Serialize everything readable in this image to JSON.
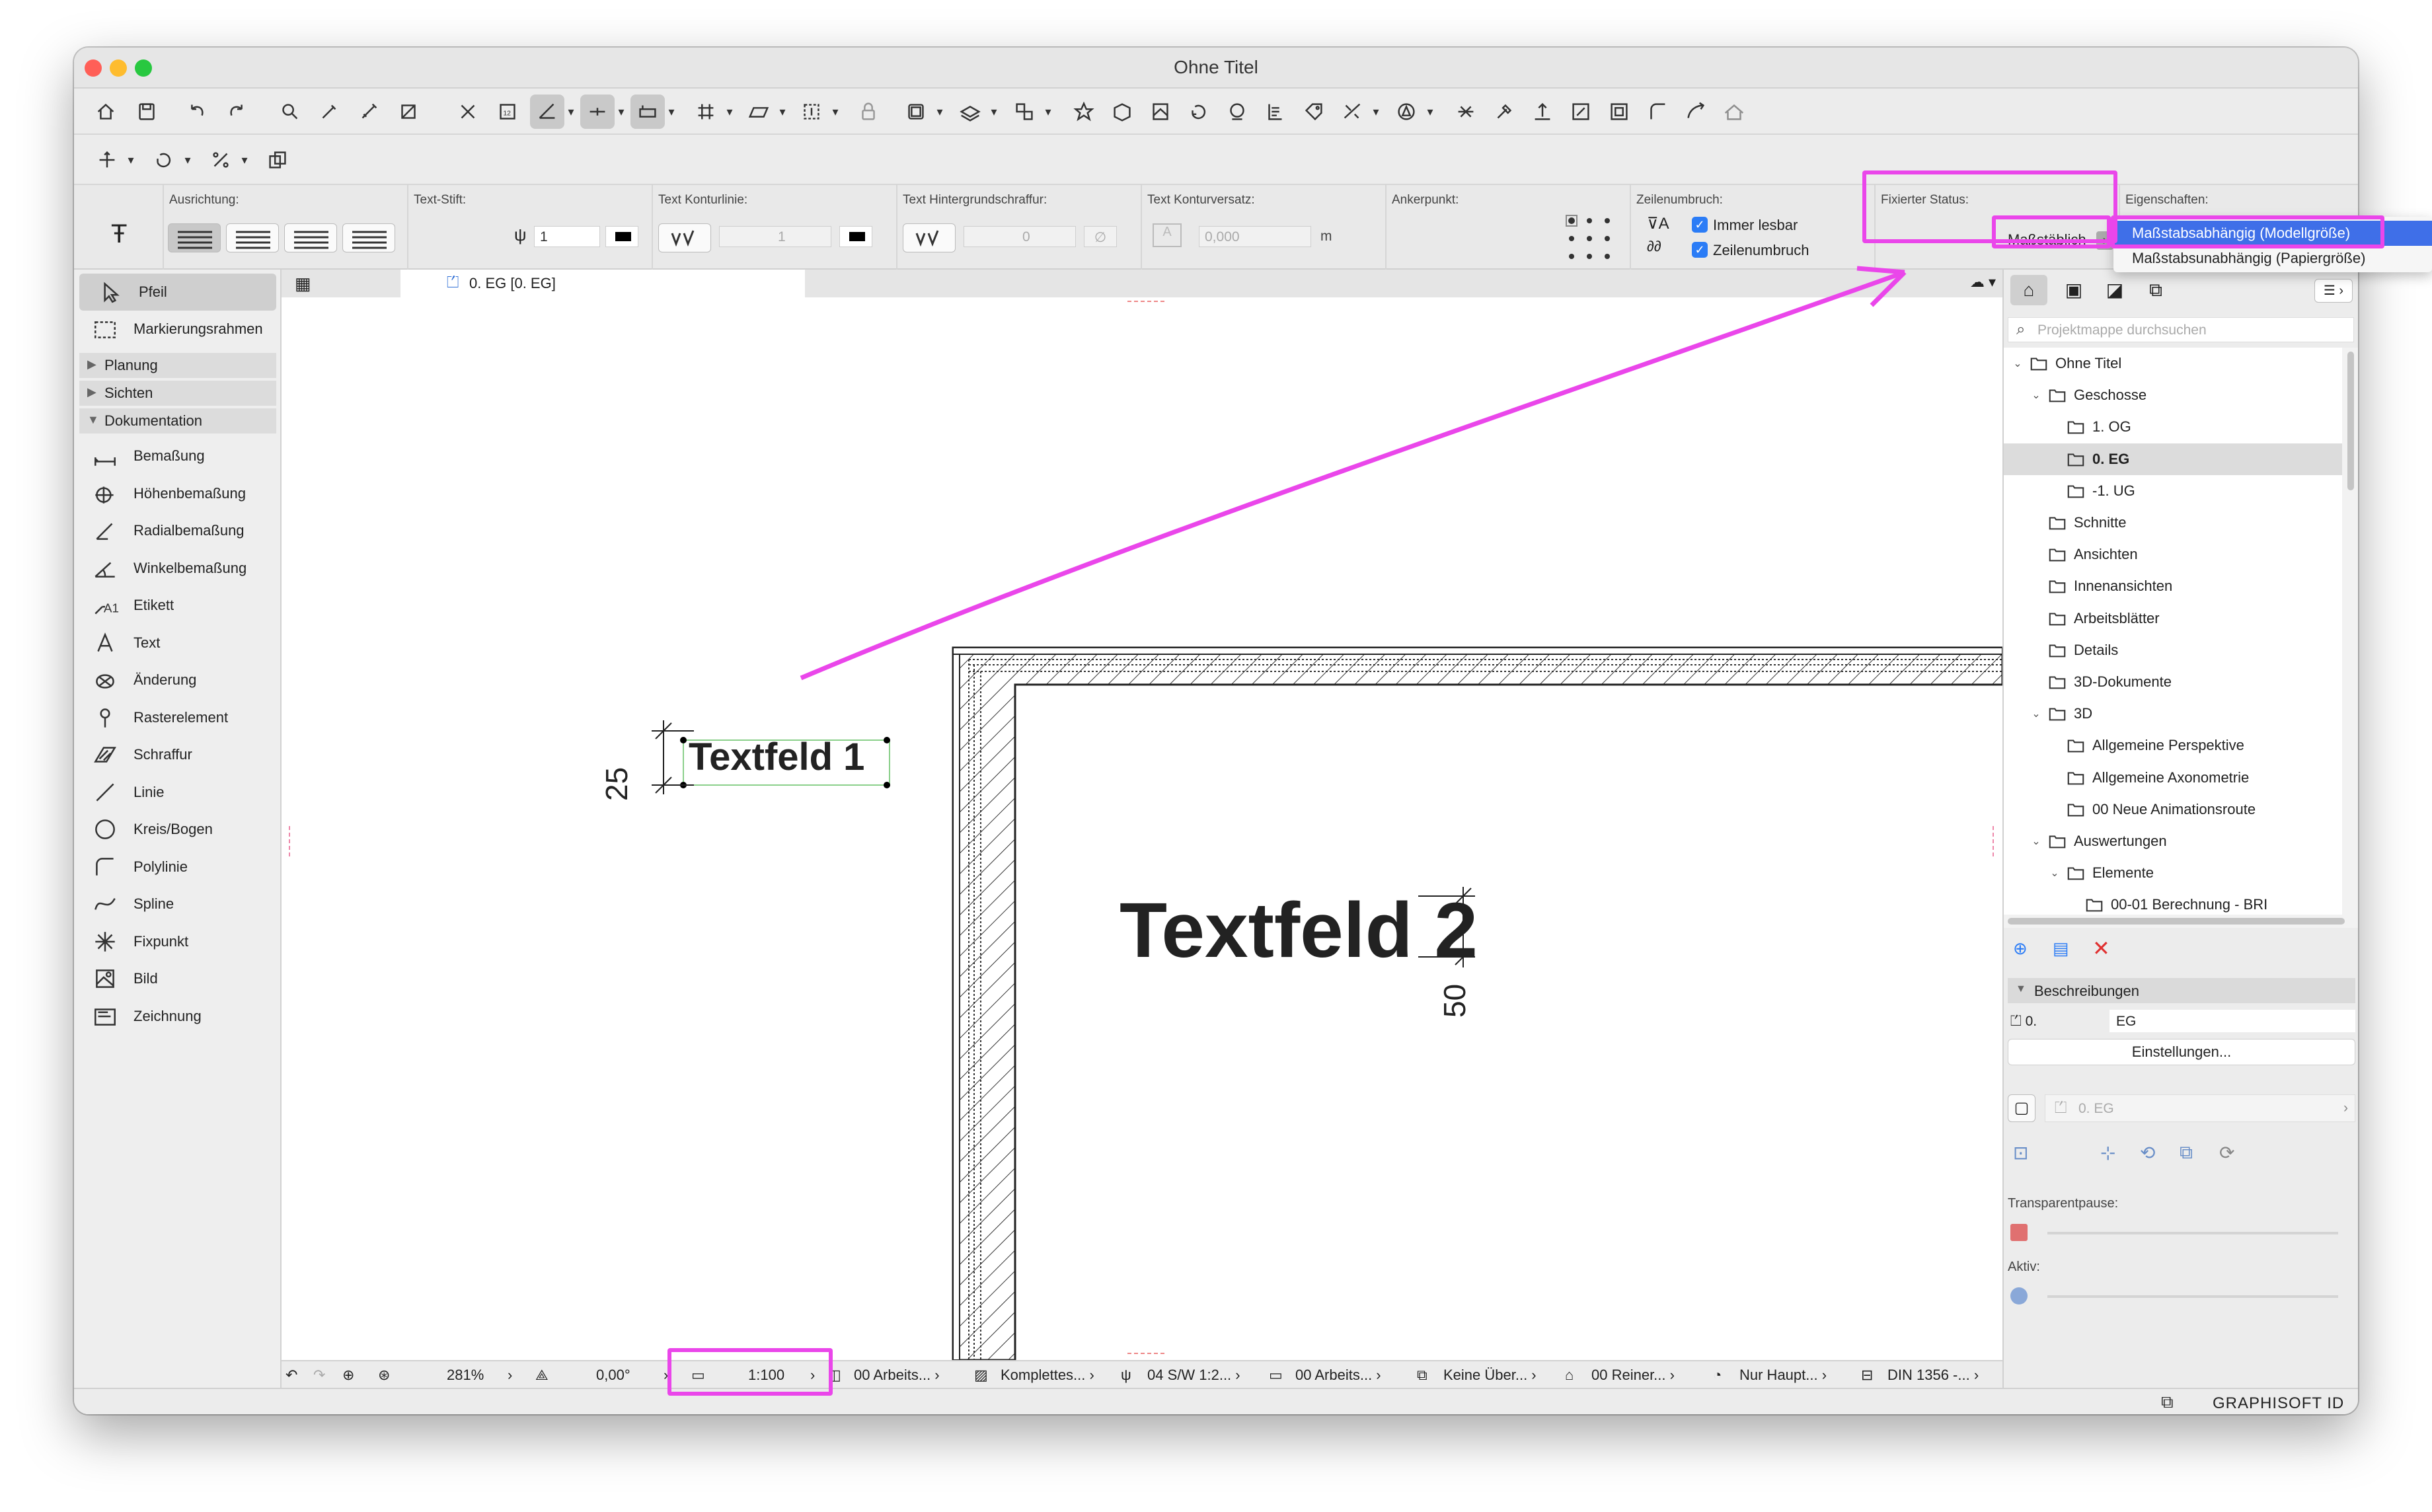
{
  "window": {
    "title": "Ohne Titel"
  },
  "info_box": {
    "ausrichtung_label": "Ausrichtung:",
    "text_stift_label": "Text-Stift:",
    "text_stift_value": "1",
    "text_konturlinie_label": "Text Konturlinie:",
    "text_konturlinie_value": "1",
    "text_hintergrund_label": "Text Hintergrundschraffur:",
    "text_hintergrund_value": "0",
    "text_konturversatz_label": "Text Konturversatz:",
    "text_konturversatz_value": "0,000",
    "text_konturversatz_unit": "m",
    "ankerpunkt_label": "Ankerpunkt:",
    "zeilenumbruch_label": "Zeilenumbruch:",
    "immer_lesbar": "Immer lesbar",
    "zeilenumbruch_opt": "Zeilenumbruch",
    "fixierter_status_label": "Fixierter Status:",
    "fixierter_status_value": "Maßstäblich",
    "eigenschaften_label": "Eigenschaften:"
  },
  "dropdown_menu": {
    "items": [
      "Maßstabsabhängig (Modellgröße)",
      "Maßstabsunabhängig (Papiergröße)"
    ],
    "selected_index": 0
  },
  "toolbox": {
    "tools_top": [
      {
        "label": "Pfeil",
        "icon": "arrow-icon"
      },
      {
        "label": "Markierungsrahmen",
        "icon": "marquee-icon"
      }
    ],
    "groups": [
      "Planung",
      "Sichten",
      "Dokumentation"
    ],
    "tools_doc": [
      {
        "label": "Bemaßung",
        "icon": "dimension-icon"
      },
      {
        "label": "Höhenbemaßung",
        "icon": "level-dimension-icon"
      },
      {
        "label": "Radialbemaßung",
        "icon": "radial-dimension-icon"
      },
      {
        "label": "Winkelbemaßung",
        "icon": "angle-dimension-icon"
      },
      {
        "label": "Etikett",
        "icon": "label-icon"
      },
      {
        "label": "Text",
        "icon": "text-icon"
      },
      {
        "label": "Änderung",
        "icon": "change-icon"
      },
      {
        "label": "Rasterelement",
        "icon": "grid-element-icon"
      },
      {
        "label": "Schraffur",
        "icon": "fill-icon"
      },
      {
        "label": "Linie",
        "icon": "line-icon"
      },
      {
        "label": "Kreis/Bogen",
        "icon": "circle-icon"
      },
      {
        "label": "Polylinie",
        "icon": "polyline-icon"
      },
      {
        "label": "Spline",
        "icon": "spline-icon"
      },
      {
        "label": "Fixpunkt",
        "icon": "hotspot-icon"
      },
      {
        "label": "Bild",
        "icon": "image-icon"
      },
      {
        "label": "Zeichnung",
        "icon": "drawing-icon"
      }
    ]
  },
  "view_tab": {
    "label": "0. EG [0. EG]"
  },
  "canvas": {
    "text1": "Textfeld 1",
    "text2": "Textfeld 2",
    "dim1": "25",
    "dim2": "50"
  },
  "statusbar": {
    "zoom": "281%",
    "angle": "0,00°",
    "scale": "1:100",
    "layer_combo": "00 Arbeits...",
    "model_view": "Komplettes...",
    "pen_set": "04 S/W 1:2...",
    "structure": "00 Arbeits...",
    "override": "Keine Über...",
    "renovation": "00 Reiner...",
    "partial": "Nur Haupt...",
    "dimension_std": "DIN 1356 -..."
  },
  "navigator": {
    "search_placeholder": "Projektmappe durchsuchen",
    "tree": [
      {
        "label": "Ohne Titel",
        "level": 0,
        "toggle": "v"
      },
      {
        "label": "Geschosse",
        "level": 1,
        "toggle": "v"
      },
      {
        "label": "1. OG",
        "level": 2,
        "toggle": ""
      },
      {
        "label": "0. EG",
        "level": 2,
        "toggle": "",
        "selected": true
      },
      {
        "label": "-1. UG",
        "level": 2,
        "toggle": ""
      },
      {
        "label": "Schnitte",
        "level": 1,
        "toggle": ""
      },
      {
        "label": "Ansichten",
        "level": 1,
        "toggle": ""
      },
      {
        "label": "Innenansichten",
        "level": 1,
        "toggle": ""
      },
      {
        "label": "Arbeitsblätter",
        "level": 1,
        "toggle": ""
      },
      {
        "label": "Details",
        "level": 1,
        "toggle": ""
      },
      {
        "label": "3D-Dokumente",
        "level": 1,
        "toggle": ""
      },
      {
        "label": "3D",
        "level": 1,
        "toggle": "v"
      },
      {
        "label": "Allgemeine Perspektive",
        "level": 2,
        "toggle": ""
      },
      {
        "label": "Allgemeine Axonometrie",
        "level": 2,
        "toggle": ""
      },
      {
        "label": "00 Neue Animationsroute",
        "level": 2,
        "toggle": ""
      },
      {
        "label": "Auswertungen",
        "level": 1,
        "toggle": "v"
      },
      {
        "label": "Elemente",
        "level": 2,
        "toggle": "v"
      },
      {
        "label": "00-01 Berechnung - BRI",
        "level": 3,
        "toggle": ""
      }
    ],
    "beschreibungen_label": "Beschreibungen",
    "prop_key": "0.",
    "prop_value": "EG",
    "einstellungen_button": "Einstellungen...",
    "view_label": "0. EG",
    "transparentpause_label": "Transparentpause:",
    "aktiv_label": "Aktiv:",
    "graphisoft_id": "GRAPHISOFT ID"
  },
  "colors": {
    "highlight": "#ea46ea",
    "selection": "#2b7cf6",
    "check": "#2b7cf6"
  }
}
